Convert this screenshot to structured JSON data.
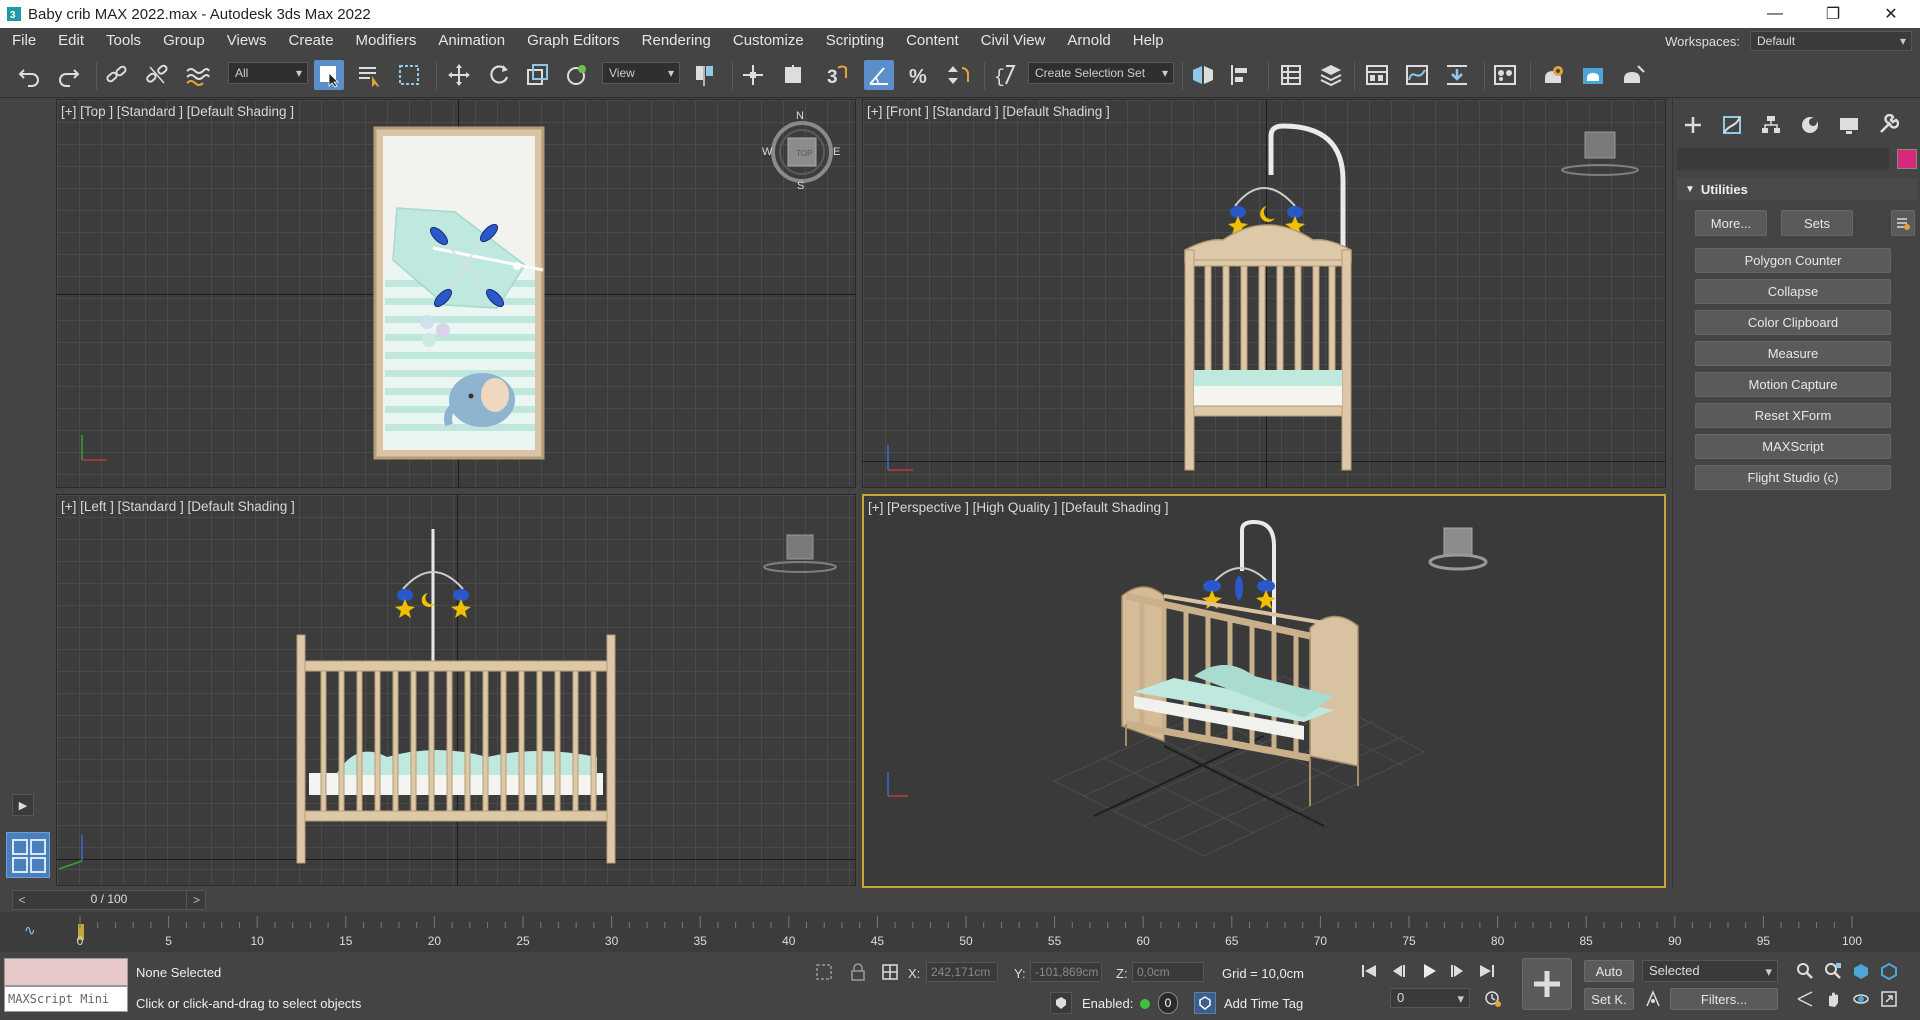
{
  "titlebar": {
    "title": "Baby crib MAX 2022.max - Autodesk 3ds Max 2022",
    "minimize": "—",
    "restore": "❐",
    "close": "✕"
  },
  "menu": [
    "File",
    "Edit",
    "Tools",
    "Group",
    "Views",
    "Create",
    "Modifiers",
    "Animation",
    "Graph Editors",
    "Rendering",
    "Customize",
    "Scripting",
    "Content",
    "Civil View",
    "Arnold",
    "Help"
  ],
  "workspace": {
    "label": "Workspaces:",
    "value": "Default"
  },
  "toolbar": {
    "filter_select": "All",
    "ref_coord_select": "View",
    "selection_set": "Create Selection Set"
  },
  "viewports": {
    "top": {
      "label": "[+] [Top ] [Standard ] [Default Shading ]",
      "compass": {
        "n": "N",
        "s": "S",
        "e": "E",
        "w": "W"
      }
    },
    "front": {
      "label": "[+] [Front ] [Standard ] [Default Shading ]"
    },
    "left": {
      "label": "[+] [Left ] [Standard ] [Default Shading ]"
    },
    "perspective": {
      "label": "[+] [Perspective ] [High Quality ] [Default Shading ]"
    }
  },
  "command_panel": {
    "rollout_title": "Utilities",
    "more_label": "More...",
    "sets_label": "Sets",
    "utilities": [
      "Polygon Counter",
      "Collapse",
      "Color Clipboard",
      "Measure",
      "Motion Capture",
      "Reset XForm",
      "MAXScript",
      "Flight Studio (c)"
    ],
    "object_color": "#d6297a"
  },
  "timeline": {
    "frame_display": "0 / 100",
    "prev": "<",
    "next": ">",
    "ticks": [
      "0",
      "5",
      "10",
      "15",
      "20",
      "25",
      "30",
      "35",
      "40",
      "45",
      "50",
      "55",
      "60",
      "65",
      "70",
      "75",
      "80",
      "85",
      "90",
      "95",
      "100"
    ]
  },
  "status": {
    "maxscript_placeholder": "MAXScript Mini",
    "selection_status": "None Selected",
    "prompt": "Click or click-and-drag to select objects",
    "x_label": "X:",
    "x_value": "242,171cm",
    "y_label": "Y:",
    "y_value": "-101,869cm",
    "z_label": "Z:",
    "z_value": "0,0cm",
    "grid": "Grid = 10,0cm",
    "enabled_label": "Enabled:",
    "enabled_count": "0",
    "add_time_tag": "Add Time Tag",
    "auto_key": "Auto",
    "set_key": "Set K.",
    "key_filter_select": "Selected",
    "filters": "Filters...",
    "current_frame": "0"
  }
}
